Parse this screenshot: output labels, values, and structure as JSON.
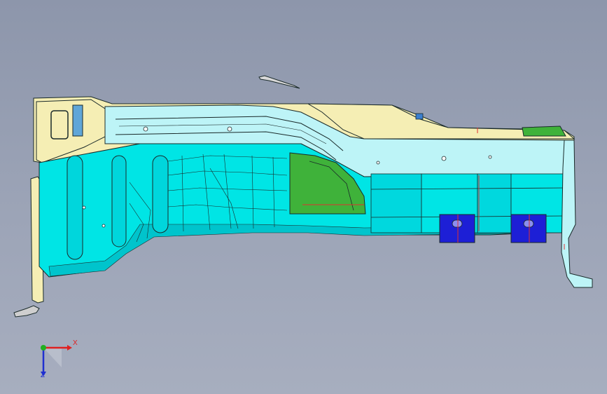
{
  "viewport": {
    "background_top": "#8d96ab",
    "background_bottom": "#a7aebf"
  },
  "model": {
    "colors": {
      "cyan_panel": "#00e5e5",
      "cyan_dark": "#00c4cc",
      "cream_panel": "#f5eeb4",
      "light_cyan": "#bdf4f7",
      "green_panel": "#3fb23a",
      "blue_bracket": "#1d1fd6",
      "red_accent": "#e03030",
      "edge_line": "#1a2a2a"
    }
  },
  "triad": {
    "x_label": "X",
    "z_label": "Z",
    "x_color": "#e02020",
    "y_color": "#20b020",
    "z_color": "#2030d0"
  }
}
